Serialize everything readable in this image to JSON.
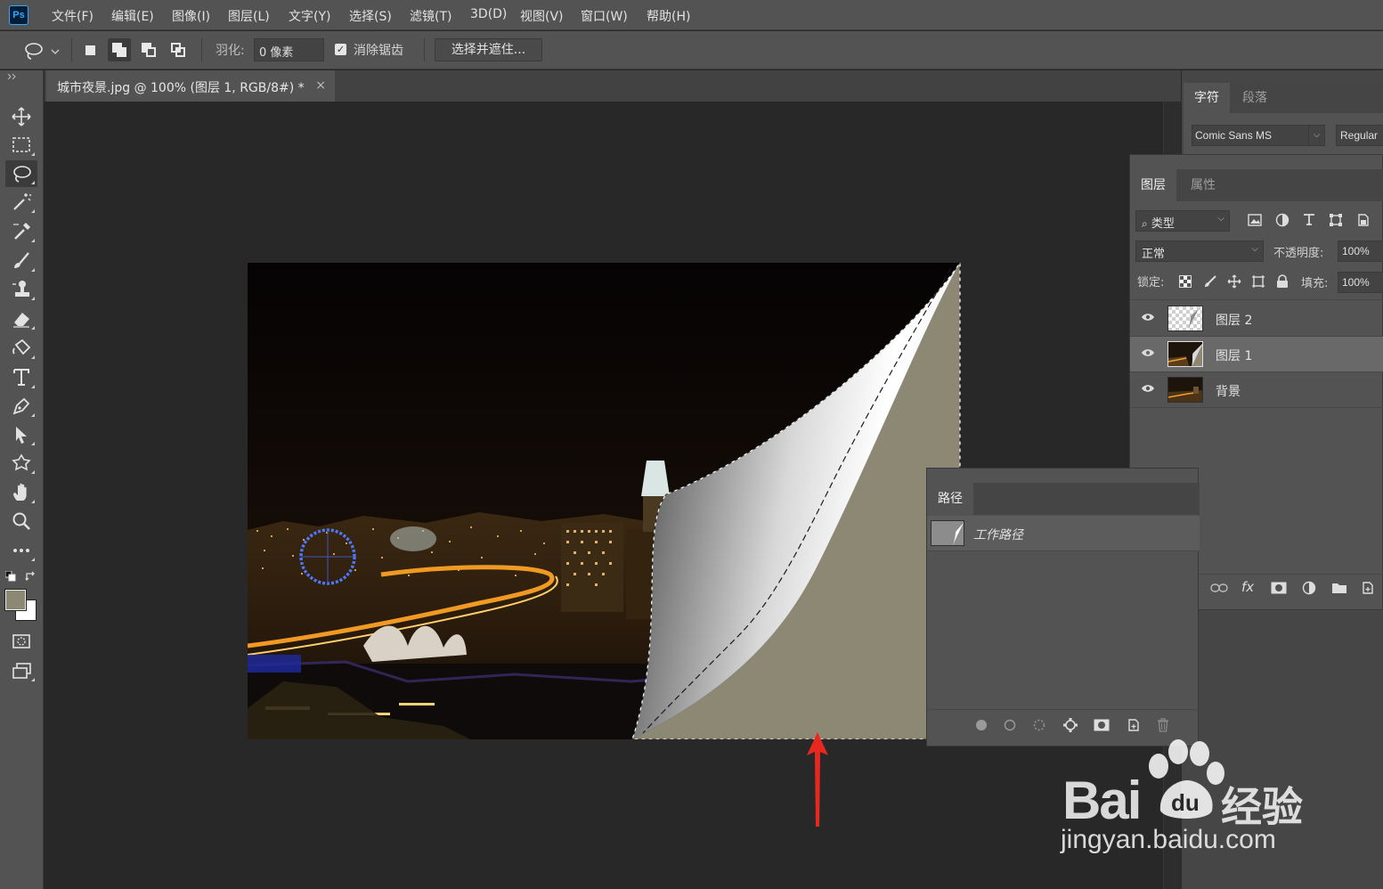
{
  "app": {
    "logo_text": "Ps"
  },
  "menu": [
    "文件(F)",
    "编辑(E)",
    "图像(I)",
    "图层(L)",
    "文字(Y)",
    "选择(S)",
    "滤镜(T)",
    "3D(D)",
    "视图(V)",
    "窗口(W)",
    "帮助(H)"
  ],
  "options": {
    "feather_label": "羽化:",
    "feather_value": "0 像素",
    "antialias_label": "消除锯齿",
    "antialias_checked": true,
    "refine_label": "选择并遮住..."
  },
  "document": {
    "tab_title": "城市夜景.jpg @ 100% (图层 1, RGB/8#) *",
    "close_glyph": "×"
  },
  "character_panel": {
    "tabs": [
      "字符",
      "段落"
    ],
    "font_family": "Comic Sans MS",
    "font_style": "Regular"
  },
  "layers_panel": {
    "tabs": [
      "图层",
      "属性"
    ],
    "filter_label": "类型",
    "blend_mode": "正常",
    "opacity_label": "不透明度:",
    "opacity_value": "100%",
    "lock_label": "锁定:",
    "fill_label": "填充:",
    "fill_value": "100%",
    "layers": [
      {
        "name": "图层 2",
        "visible": true,
        "selected": false
      },
      {
        "name": "图层 1",
        "visible": true,
        "selected": true
      },
      {
        "name": "背景",
        "visible": true,
        "selected": false
      }
    ],
    "footer_fx": "fx"
  },
  "paths_panel": {
    "tab": "路径",
    "paths": [
      {
        "name": "工作路径"
      }
    ]
  },
  "colors": {
    "foreground": "#8d8873",
    "background": "#ffffff",
    "fill_color": "#8d8873",
    "arrow_color": "#e8281e",
    "ps_blue": "#31a8ff"
  },
  "watermark": {
    "brand": "Bai",
    "brand_cn": "经验",
    "url": "jingyan.baidu.com"
  }
}
